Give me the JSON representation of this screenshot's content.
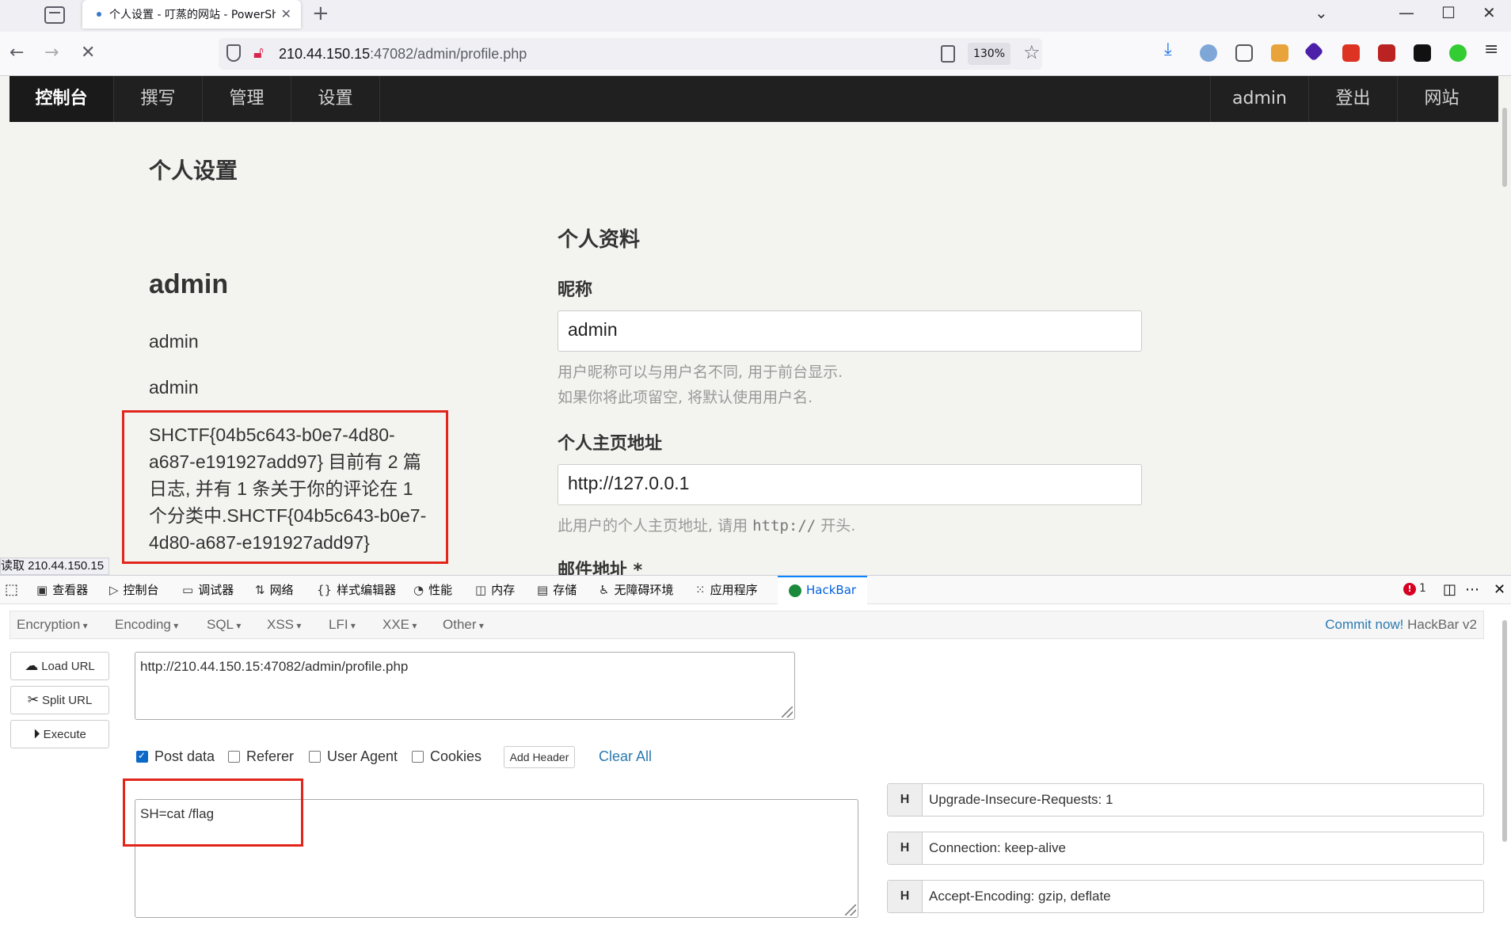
{
  "browser": {
    "tab_title": "个人设置 - 叮蒸的网站 - PowerShell",
    "url_host": "210.44.150.15",
    "url_rest": ":47082/admin/profile.php",
    "zoom": "130%",
    "status_tip": "读取 210.44.150.15"
  },
  "site": {
    "nav": [
      "控制台",
      "撰写",
      "管理",
      "设置"
    ],
    "nav_right": [
      "admin",
      "登出",
      "网站"
    ],
    "page_title": "个人设置",
    "profile": {
      "name": "admin",
      "line1": "admin",
      "line2": "admin",
      "flag_text": "SHCTF{04b5c643-b0e7-4d80-a687-e191927add97} 目前有 2 篇日志, 并有 1 条关于你的评论在 1 个分类中.SHCTF{04b5c643-b0e7-4d80-a687-e191927add97}"
    },
    "form": {
      "section_title": "个人资料",
      "nickname_label": "昵称",
      "nickname_value": "admin",
      "nickname_help_1": "用户昵称可以与用户名不同, 用于前台显示.",
      "nickname_help_2": "如果你将此项留空, 将默认使用用户名.",
      "homepage_label": "个人主页地址",
      "homepage_value": "http://127.0.0.1",
      "homepage_help_pre": "此用户的个人主页地址, 请用",
      "homepage_help_code": "http://",
      "homepage_help_post": "开头.",
      "email_label": "邮件地址 *"
    }
  },
  "devtools": {
    "tabs": [
      "查看器",
      "控制台",
      "调试器",
      "网络",
      "样式编辑器",
      "性能",
      "内存",
      "存储",
      "无障碍环境",
      "应用程序",
      "HackBar"
    ],
    "error_count": "1",
    "hackbar": {
      "menu": [
        "Encryption",
        "Encoding",
        "SQL",
        "XSS",
        "LFI",
        "XXE",
        "Other"
      ],
      "commit_link": "Commit now!",
      "commit_rest": " HackBar v2",
      "load_url": "Load URL",
      "split_url": "Split URL",
      "execute": "Execute",
      "url_value": "http://210.44.150.15:47082/admin/profile.php",
      "checks": [
        {
          "label": "Post data",
          "checked": true
        },
        {
          "label": "Referer",
          "checked": false
        },
        {
          "label": "User Agent",
          "checked": false
        },
        {
          "label": "Cookies",
          "checked": false
        }
      ],
      "add_header": "Add Header",
      "clear_all": "Clear All",
      "post_value": "SH=cat /flag",
      "headers": [
        {
          "key": "H",
          "value": "Upgrade-Insecure-Requests: 1"
        },
        {
          "key": "H",
          "value": "Connection: keep-alive"
        },
        {
          "key": "H",
          "value": "Accept-Encoding: gzip, deflate"
        }
      ]
    }
  },
  "colors": {
    "accent": "#0a84ff",
    "highlight_box": "#e1251b",
    "site_nav_bg": "#202020",
    "hackbar_green": "#1b8a3d"
  }
}
